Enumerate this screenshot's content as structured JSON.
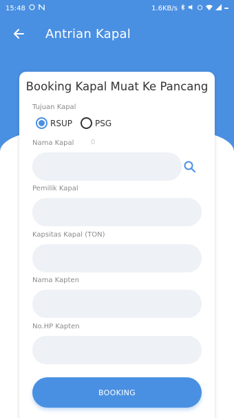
{
  "status_bar": {
    "time": "15:48",
    "network_speed": "1.6KB/s",
    "battery_icon": "battery-icon"
  },
  "app_bar": {
    "title": "Antrian Kapal",
    "back_icon": "arrow-left-icon"
  },
  "colors": {
    "primary": "#4a90e2",
    "input_bg": "#eef1f6"
  },
  "form": {
    "title": "Booking Kapal Muat Ke Pancang",
    "tujuan_label": "Tujuan Kapal",
    "options": [
      {
        "label": "RSUP",
        "selected": true
      },
      {
        "label": "PSG",
        "selected": false
      }
    ],
    "nama_kapal_label": "Nama Kapal",
    "nama_kapal_counter": "0",
    "nama_kapal_value": "",
    "pemilik_label": "Pemilik Kapal",
    "pemilik_value": "",
    "kapasitas_label": "Kapsitas Kapal (TON)",
    "kapasitas_value": "",
    "nakhoda_label": "Nama Kapten",
    "nakhoda_value": "",
    "nohp_label": "No.HP Kapten",
    "nohp_value": "",
    "submit_label": "BOOKING"
  }
}
